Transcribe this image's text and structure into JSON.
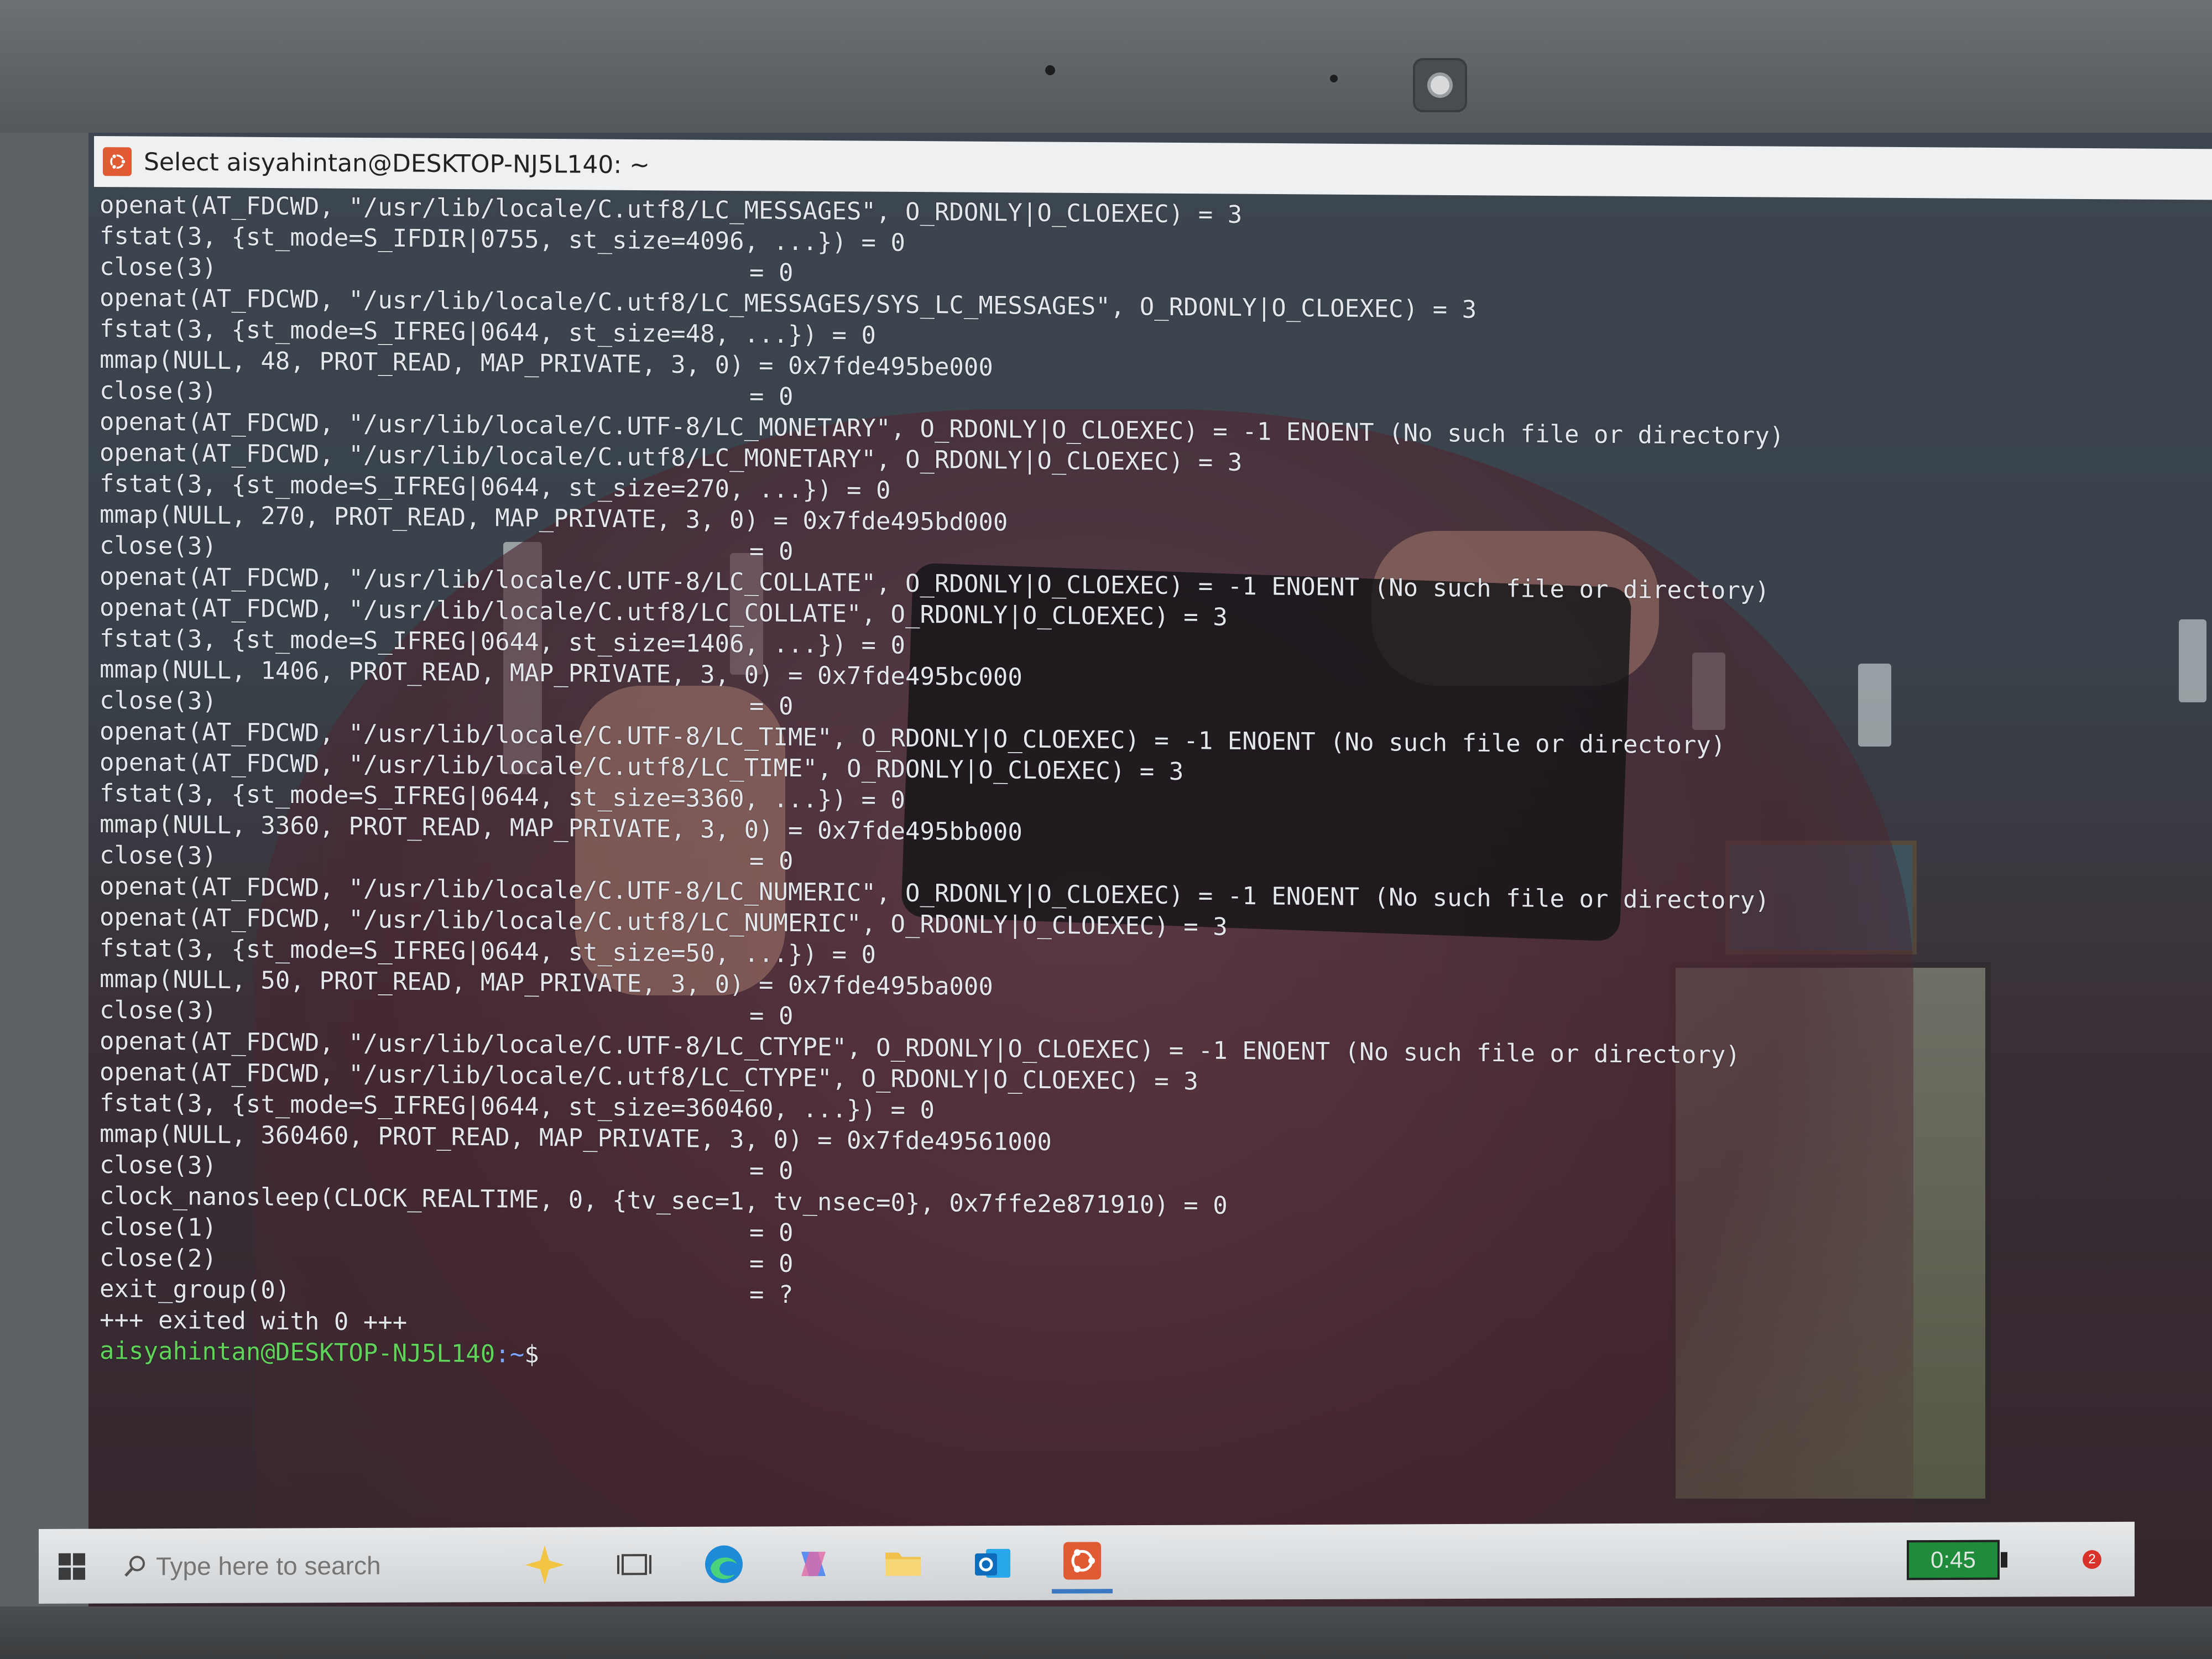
{
  "window": {
    "title": "Select aisyahintan@DESKTOP-NJ5L140: ~"
  },
  "terminal": {
    "lines": [
      {
        "call": "openat(AT_FDCWD, \"/usr/lib/locale/C.utf8/LC_MESSAGES\", O_RDONLY|O_CLOEXEC) = 3",
        "ret": ""
      },
      {
        "call": "fstat(3, {st_mode=S_IFDIR|0755, st_size=4096, ...}) = 0",
        "ret": ""
      },
      {
        "call": "close(3)",
        "ret": "= 0"
      },
      {
        "call": "openat(AT_FDCWD, \"/usr/lib/locale/C.utf8/LC_MESSAGES/SYS_LC_MESSAGES\", O_RDONLY|O_CLOEXEC) = 3",
        "ret": ""
      },
      {
        "call": "fstat(3, {st_mode=S_IFREG|0644, st_size=48, ...}) = 0",
        "ret": ""
      },
      {
        "call": "mmap(NULL, 48, PROT_READ, MAP_PRIVATE, 3, 0) = 0x7fde495be000",
        "ret": ""
      },
      {
        "call": "close(3)",
        "ret": "= 0"
      },
      {
        "call": "openat(AT_FDCWD, \"/usr/lib/locale/C.UTF-8/LC_MONETARY\", O_RDONLY|O_CLOEXEC) = -1 ENOENT (No such file or directory)",
        "ret": ""
      },
      {
        "call": "openat(AT_FDCWD, \"/usr/lib/locale/C.utf8/LC_MONETARY\", O_RDONLY|O_CLOEXEC) = 3",
        "ret": ""
      },
      {
        "call": "fstat(3, {st_mode=S_IFREG|0644, st_size=270, ...}) = 0",
        "ret": ""
      },
      {
        "call": "mmap(NULL, 270, PROT_READ, MAP_PRIVATE, 3, 0) = 0x7fde495bd000",
        "ret": ""
      },
      {
        "call": "close(3)",
        "ret": "= 0"
      },
      {
        "call": "openat(AT_FDCWD, \"/usr/lib/locale/C.UTF-8/LC_COLLATE\", O_RDONLY|O_CLOEXEC) = -1 ENOENT (No such file or directory)",
        "ret": ""
      },
      {
        "call": "openat(AT_FDCWD, \"/usr/lib/locale/C.utf8/LC_COLLATE\", O_RDONLY|O_CLOEXEC) = 3",
        "ret": ""
      },
      {
        "call": "fstat(3, {st_mode=S_IFREG|0644, st_size=1406, ...}) = 0",
        "ret": ""
      },
      {
        "call": "mmap(NULL, 1406, PROT_READ, MAP_PRIVATE, 3, 0) = 0x7fde495bc000",
        "ret": ""
      },
      {
        "call": "close(3)",
        "ret": "= 0"
      },
      {
        "call": "openat(AT_FDCWD, \"/usr/lib/locale/C.UTF-8/LC_TIME\", O_RDONLY|O_CLOEXEC) = -1 ENOENT (No such file or directory)",
        "ret": ""
      },
      {
        "call": "openat(AT_FDCWD, \"/usr/lib/locale/C.utf8/LC_TIME\", O_RDONLY|O_CLOEXEC) = 3",
        "ret": ""
      },
      {
        "call": "fstat(3, {st_mode=S_IFREG|0644, st_size=3360, ...}) = 0",
        "ret": ""
      },
      {
        "call": "mmap(NULL, 3360, PROT_READ, MAP_PRIVATE, 3, 0) = 0x7fde495bb000",
        "ret": ""
      },
      {
        "call": "close(3)",
        "ret": "= 0"
      },
      {
        "call": "openat(AT_FDCWD, \"/usr/lib/locale/C.UTF-8/LC_NUMERIC\", O_RDONLY|O_CLOEXEC) = -1 ENOENT (No such file or directory)",
        "ret": ""
      },
      {
        "call": "openat(AT_FDCWD, \"/usr/lib/locale/C.utf8/LC_NUMERIC\", O_RDONLY|O_CLOEXEC) = 3",
        "ret": ""
      },
      {
        "call": "fstat(3, {st_mode=S_IFREG|0644, st_size=50, ...}) = 0",
        "ret": ""
      },
      {
        "call": "mmap(NULL, 50, PROT_READ, MAP_PRIVATE, 3, 0) = 0x7fde495ba000",
        "ret": ""
      },
      {
        "call": "close(3)",
        "ret": "= 0"
      },
      {
        "call": "openat(AT_FDCWD, \"/usr/lib/locale/C.UTF-8/LC_CTYPE\", O_RDONLY|O_CLOEXEC) = -1 ENOENT (No such file or directory)",
        "ret": ""
      },
      {
        "call": "openat(AT_FDCWD, \"/usr/lib/locale/C.utf8/LC_CTYPE\", O_RDONLY|O_CLOEXEC) = 3",
        "ret": ""
      },
      {
        "call": "fstat(3, {st_mode=S_IFREG|0644, st_size=360460, ...}) = 0",
        "ret": ""
      },
      {
        "call": "mmap(NULL, 360460, PROT_READ, MAP_PRIVATE, 3, 0) = 0x7fde49561000",
        "ret": ""
      },
      {
        "call": "close(3)",
        "ret": "= 0"
      },
      {
        "call": "clock_nanosleep(CLOCK_REALTIME, 0, {tv_sec=1, tv_nsec=0}, 0x7ffe2e871910) = 0",
        "ret": ""
      },
      {
        "call": "close(1)",
        "ret": "= 0"
      },
      {
        "call": "close(2)",
        "ret": "= 0"
      },
      {
        "call": "exit_group(0)",
        "ret": "= ?"
      },
      {
        "call": "+++ exited with 0 +++",
        "ret": ""
      }
    ],
    "prompt": {
      "user_host": "aisyahintan@DESKTOP-NJ5L140",
      "path": ":~",
      "symbol": "$"
    }
  },
  "taskbar": {
    "search_placeholder": "Type here to search",
    "icons": [
      "task-view-icon",
      "edge-icon",
      "copilot-icon",
      "file-explorer-icon",
      "outlook-icon",
      "ubuntu-icon"
    ],
    "battery_time": "0:45",
    "notification_count": "2"
  },
  "colors": {
    "prompt_user": "#5fd35a",
    "prompt_path": "#7aa7ff",
    "terminal_text": "#e3e6ea",
    "ubuntu_orange": "#e05a34"
  }
}
